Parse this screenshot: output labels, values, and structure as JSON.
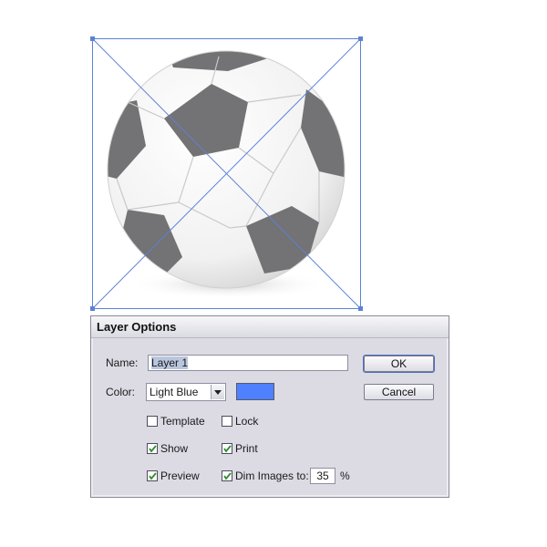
{
  "dialog": {
    "title": "Layer Options",
    "name_label": "Name:",
    "name_value": "Layer 1",
    "color_label": "Color:",
    "color_value": "Light Blue",
    "color_swatch": "#4f80ff",
    "ok_label": "OK",
    "cancel_label": "Cancel",
    "checkboxes": {
      "template": {
        "label": "Template",
        "checked": false
      },
      "lock": {
        "label": "Lock",
        "checked": false
      },
      "show": {
        "label": "Show",
        "checked": true
      },
      "print": {
        "label": "Print",
        "checked": true
      },
      "preview": {
        "label": "Preview",
        "checked": true
      },
      "dim_images": {
        "label": "Dim Images to:",
        "checked": true
      }
    },
    "dim_value": "35",
    "dim_unit": "%"
  },
  "colors": {
    "selection": "#5b82d6",
    "check": "#2f8a2f"
  }
}
